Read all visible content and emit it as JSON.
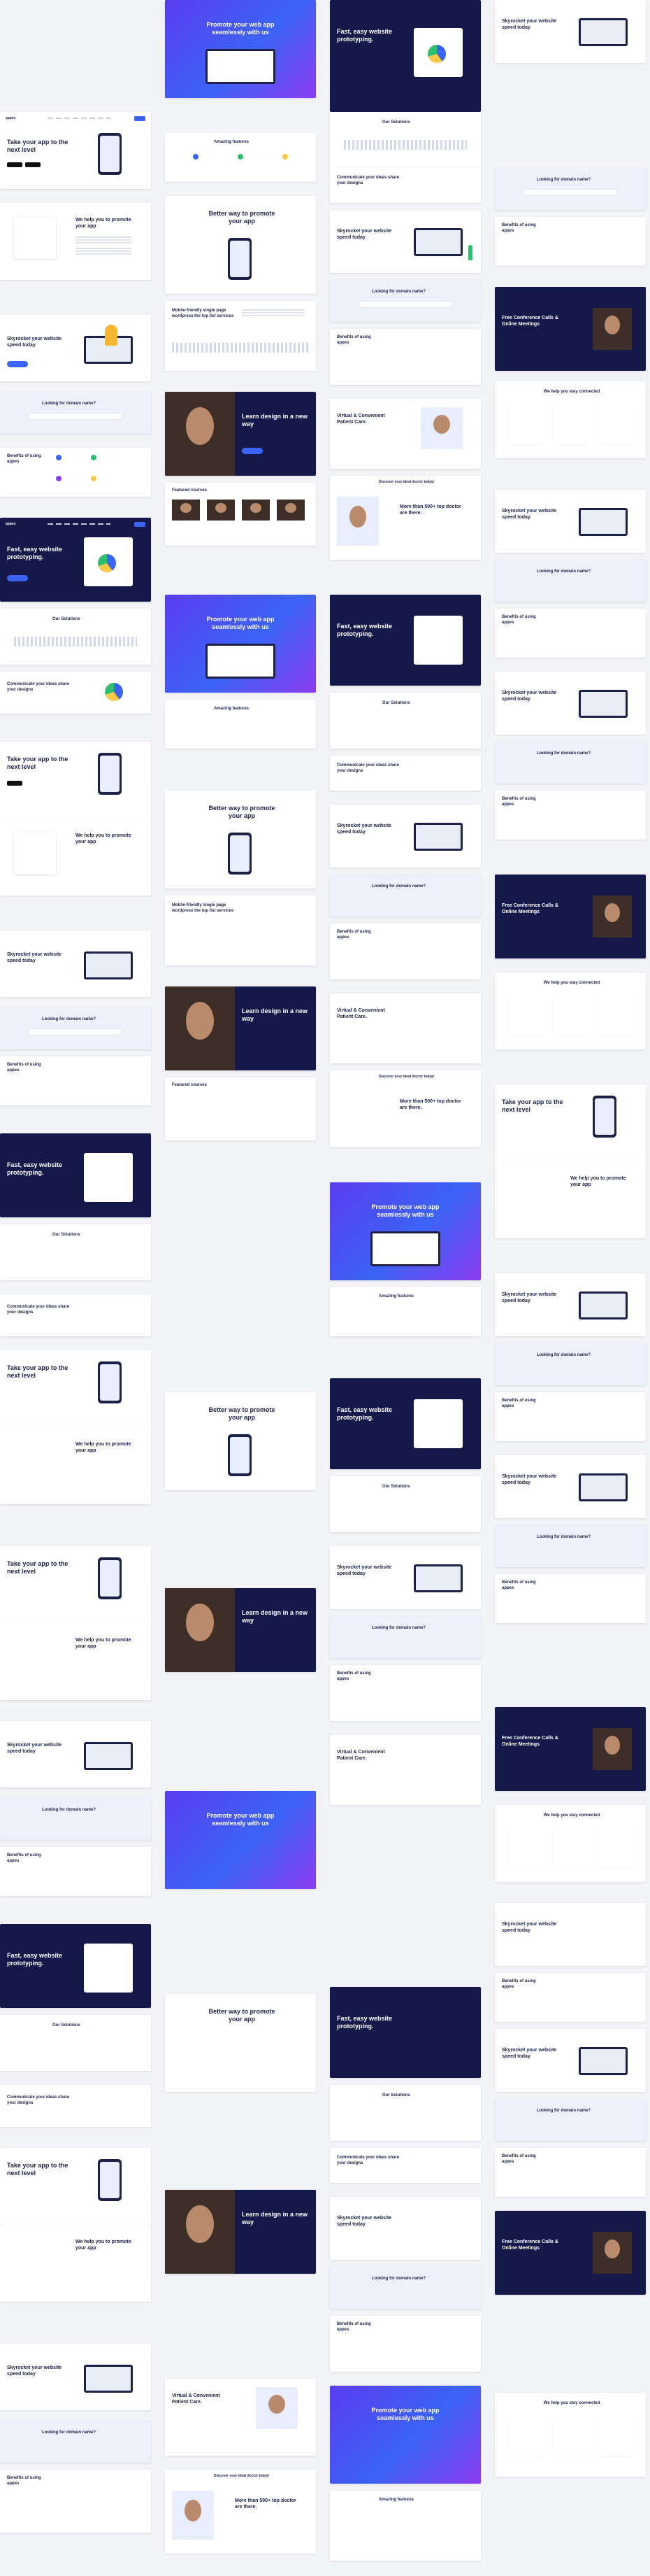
{
  "board": {
    "headings": {
      "app_next_level": "Take your app to the next level",
      "help_promote": "We help you to promote your app",
      "skyrocket": "Skyrocket your website speed today",
      "domain": "Looking for domain name?",
      "benefits": "Benefits of using appes",
      "fast_prototyping": "Fast, easy website prototyping.",
      "our_solutions": "Our Solutions",
      "communicate": "Communicate your ideas share your designs",
      "promote_web_app": "Promote your web app seamlessly with us",
      "amazing_features": "Amazing features",
      "better_way": "Better way to promote your app",
      "mobile_friendly": "Mobile-friendly single page wordpress the top list services",
      "learn_design": "Learn design in a new way",
      "featured_courses": "Featured courses",
      "virtual_care": "Virtual & Convenient Patient Care.",
      "discover_doctor": "Discover your ideal doctor today!",
      "more_than": "More than 500+ top doctor are there.",
      "conference_calls": "Free Conference Calls & Online Meetings",
      "stay_connected": "We help you stay connected"
    }
  }
}
